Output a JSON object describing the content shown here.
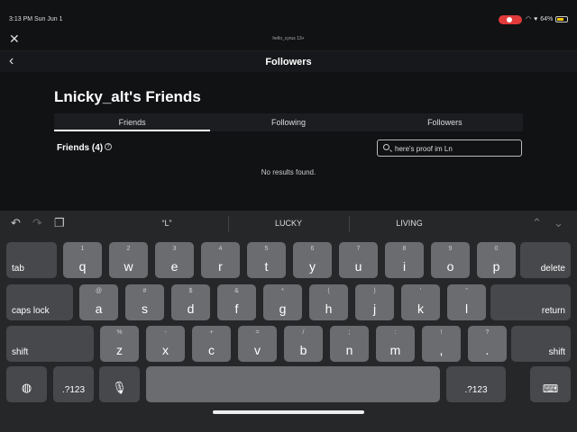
{
  "status": {
    "time": "3:13 PM",
    "date": "Sun Jun 1",
    "battery": "64%"
  },
  "header": {
    "username": "hello_cyrus 13+",
    "title": "Followers"
  },
  "page": {
    "heading": "Lnicky_alt's Friends",
    "tabs": [
      "Friends",
      "Following",
      "Followers"
    ],
    "friends_count": "Friends (4)",
    "search_value": "here's proof im Ln",
    "no_results": "No results found."
  },
  "keyboard": {
    "suggestions": [
      "“L”",
      "LUCKY",
      "LIVING"
    ],
    "row1": {
      "tab": "tab",
      "keys": [
        [
          "1",
          "q"
        ],
        [
          "2",
          "w"
        ],
        [
          "3",
          "e"
        ],
        [
          "4",
          "r"
        ],
        [
          "5",
          "t"
        ],
        [
          "6",
          "y"
        ],
        [
          "7",
          "u"
        ],
        [
          "8",
          "i"
        ],
        [
          "9",
          "o"
        ],
        [
          "0",
          "p"
        ]
      ],
      "delete": "delete"
    },
    "row2": {
      "caps": "caps lock",
      "keys": [
        [
          "@",
          "a"
        ],
        [
          "#",
          "s"
        ],
        [
          "$",
          "d"
        ],
        [
          "&",
          "f"
        ],
        [
          "*",
          "g"
        ],
        [
          "(",
          "h"
        ],
        [
          ")",
          "j"
        ],
        [
          "’",
          "k"
        ],
        [
          "”",
          "l"
        ]
      ],
      "return": "return"
    },
    "row3": {
      "shift": "shift",
      "keys": [
        [
          "%",
          "z"
        ],
        [
          "-",
          "x"
        ],
        [
          "+",
          "c"
        ],
        [
          "=",
          "v"
        ],
        [
          "/",
          "b"
        ],
        [
          ";",
          "n"
        ],
        [
          ":",
          "m"
        ],
        [
          "!",
          ","
        ],
        [
          "?",
          "."
        ]
      ]
    },
    "row4": {
      "num": ".?123"
    }
  }
}
